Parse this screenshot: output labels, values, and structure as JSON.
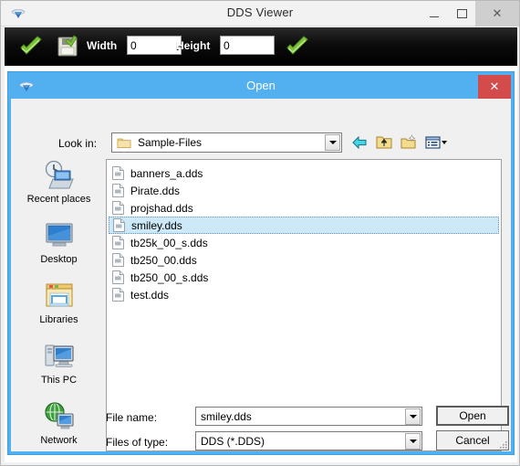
{
  "app": {
    "title": "DDS Viewer",
    "icon": "dds-app-icon",
    "window_controls": [
      {
        "name": "minimize",
        "label": "—"
      },
      {
        "name": "maximize",
        "label": "☐"
      },
      {
        "name": "close",
        "label": "✕"
      }
    ]
  },
  "toolbar": {
    "open_icon": "open-check-icon",
    "save_icon": "save-disk-icon",
    "width_label": "Width",
    "width_value": "0",
    "height_label": "Height",
    "height_value": "0",
    "apply_icon": "green-check-icon"
  },
  "dialog": {
    "title": "Open",
    "icon": "dds-app-icon",
    "close_label": "✕",
    "lookin": {
      "label": "Look in:",
      "value": "Sample-Files",
      "folder_icon": "folder-icon",
      "dropdown_icon": "chevron-down-icon"
    },
    "nav_icons": [
      {
        "name": "back-icon",
        "title": "Back"
      },
      {
        "name": "up-folder-icon",
        "title": "Up One Level"
      },
      {
        "name": "new-folder-icon",
        "title": "Create New Folder"
      },
      {
        "name": "views-icon",
        "title": "Views"
      }
    ],
    "places": [
      {
        "label": "Recent places",
        "icon": "recent-places-icon"
      },
      {
        "label": "Desktop",
        "icon": "desktop-icon"
      },
      {
        "label": "Libraries",
        "icon": "libraries-icon"
      },
      {
        "label": "This PC",
        "icon": "this-pc-icon"
      },
      {
        "label": "Network",
        "icon": "network-icon"
      }
    ],
    "files": [
      {
        "name": "banners_a.dds",
        "selected": false,
        "icon": "file-icon"
      },
      {
        "name": "Pirate.dds",
        "selected": false,
        "icon": "file-icon"
      },
      {
        "name": "projshad.dds",
        "selected": false,
        "icon": "file-icon"
      },
      {
        "name": "smiley.dds",
        "selected": true,
        "icon": "file-icon"
      },
      {
        "name": "tb25k_00_s.dds",
        "selected": false,
        "icon": "file-icon"
      },
      {
        "name": "tb250_00.dds",
        "selected": false,
        "icon": "file-icon"
      },
      {
        "name": "tb250_00_s.dds",
        "selected": false,
        "icon": "file-icon"
      },
      {
        "name": "test.dds",
        "selected": false,
        "icon": "file-icon"
      }
    ],
    "filename": {
      "label": "File name:",
      "value": "smiley.dds"
    },
    "filetype": {
      "label": "Files of type:",
      "value": "DDS (*.DDS)"
    },
    "buttons": {
      "open": "Open",
      "cancel": "Cancel"
    }
  },
  "colors": {
    "dialog_border": "#52aff0",
    "title_bar": "#52aff0",
    "close_red": "#d44b4b",
    "selection": "#cde8f7",
    "toolbar_bg": "#000000",
    "accent_green": "#6ab630"
  }
}
